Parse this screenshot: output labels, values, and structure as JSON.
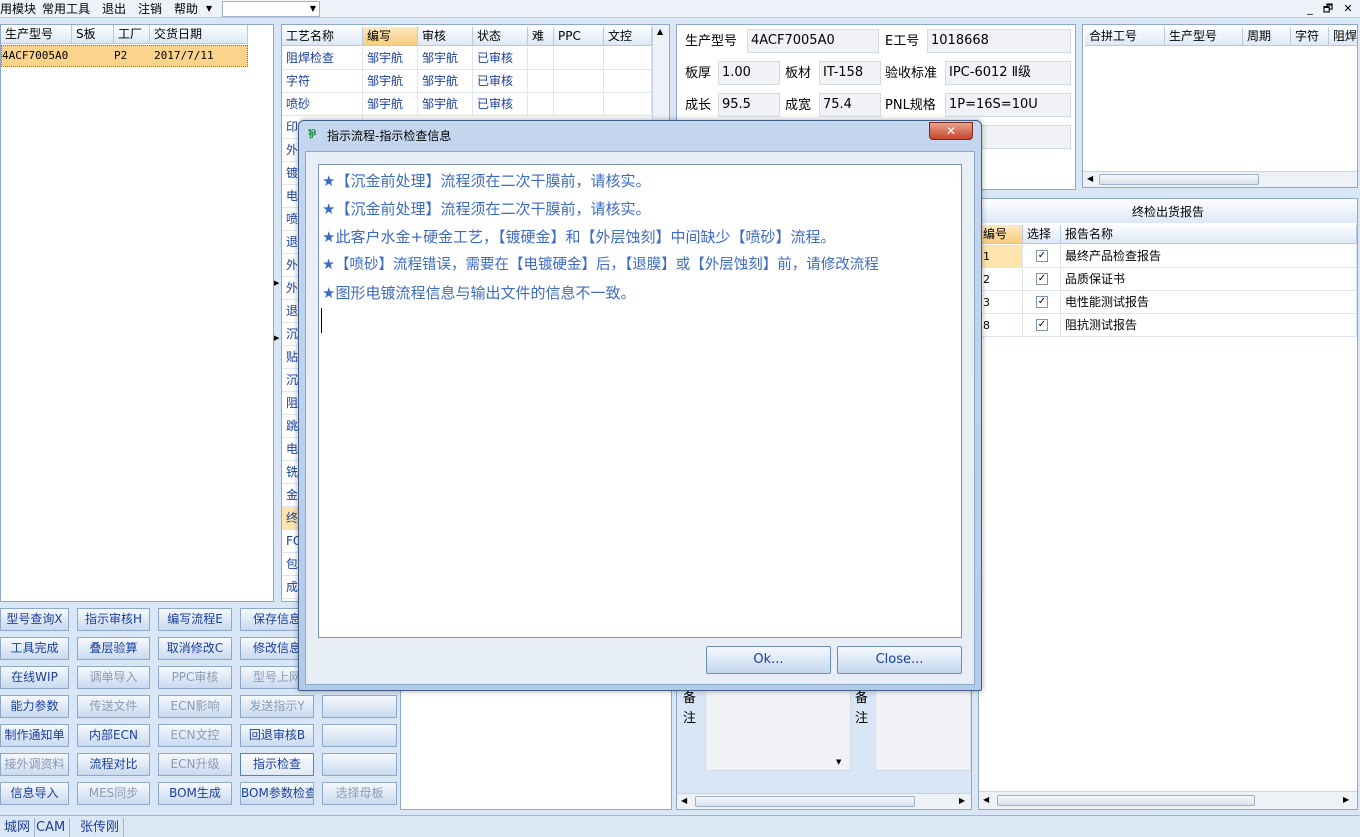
{
  "menubar": {
    "items": [
      "用模块",
      "常用工具",
      "退出",
      "注销",
      "帮助"
    ],
    "combo_value": "",
    "window_buttons": [
      "_",
      "🗗",
      "✕"
    ]
  },
  "model_list": {
    "headers": [
      "生产型号",
      "S板",
      "工厂",
      "交货日期"
    ],
    "rows": [
      [
        "4ACF7005A0",
        "",
        "P2",
        "2017/7/11"
      ]
    ]
  },
  "process_table": {
    "headers": [
      "工艺名称",
      "编写",
      "审核",
      "状态",
      "难",
      "PPC",
      "文控"
    ],
    "rows": [
      [
        "阻焊检查",
        "邹宇航",
        "邹宇航",
        "已审核"
      ],
      [
        "字符",
        "邹宇航",
        "邹宇航",
        "已审核"
      ],
      [
        "喷砂",
        "邹宇航",
        "邹宇航",
        "已审核"
      ]
    ],
    "partial_rows": [
      "印",
      "外",
      "镀",
      "电",
      "喷",
      "退",
      "外",
      "外",
      "退",
      "沉",
      "贴",
      "沉",
      "阻",
      "跳",
      "电",
      "铣",
      "金",
      "终",
      "FQ",
      "包",
      "成"
    ]
  },
  "buttons": {
    "rows": [
      [
        "型号查询X",
        "指示审核H",
        "编写流程E",
        "保存信息"
      ],
      [
        "工具完成",
        "叠层验算",
        "取消修改C",
        "修改信息"
      ],
      [
        "在线WIP",
        "调单导入",
        "PPC审核",
        "型号上网"
      ],
      [
        "能力参数",
        "传送文件",
        "ECN影响",
        "发送指示Y"
      ],
      [
        "制作通知单",
        "内部ECN",
        "ECN文控",
        "回退审核B"
      ],
      [
        "接外调资料",
        "流程对比",
        "ECN升级",
        "指示检查"
      ],
      [
        "信息导入",
        "MES同步",
        "BOM生成",
        "BOM参数检查",
        "选择母板"
      ]
    ]
  },
  "info": {
    "model_label": "生产型号",
    "model_value": "4ACF7005A0",
    "e_label": "E工号",
    "e_value": "1018668",
    "thick_label": "板厚",
    "thick_value": "1.00",
    "mat_label": "板材",
    "mat_value": "IT-158",
    "std_label": "验收标准",
    "std_value": "IPC-6012 Ⅱ级",
    "len_label": "成长",
    "len_value": "95.5",
    "wid_label": "成宽",
    "wid_value": "75.4",
    "pnl_label": "PNL规格",
    "pnl_value": "1P=16S=10U",
    "remark1": "备注",
    "remark2": "备注"
  },
  "merge_table": {
    "headers": [
      "合拼工号",
      "生产型号",
      "周期",
      "字符",
      "阻焊"
    ]
  },
  "report_table": {
    "title": "终检出货报告",
    "headers": [
      "编号",
      "选择",
      "报告名称"
    ],
    "rows": [
      [
        "1",
        "最终产品检查报告"
      ],
      [
        "2",
        "品质保证书"
      ],
      [
        "3",
        "电性能测试报告"
      ],
      [
        "8",
        "阻抗测试报告"
      ]
    ]
  },
  "statusbar": {
    "items": [
      "城网",
      "CAM",
      "张传刚"
    ]
  },
  "dialog": {
    "title": "指示流程-指示检查信息",
    "messages": [
      "★【沉金前处理】流程须在二次干膜前，请核实。",
      "★【沉金前处理】流程须在二次干膜前，请核实。",
      "★此客户水金+硬金工艺，【镀硬金】和【外层蚀刻】中间缺少【喷砂】流程。",
      "★【喷砂】流程错误，需要在【电镀硬金】后，【退膜】或【外层蚀刻】前，请修改流程",
      "★图形电镀流程信息与输出文件的信息不一致。"
    ],
    "ok_label": "Ok...",
    "close_label": "Close..."
  }
}
